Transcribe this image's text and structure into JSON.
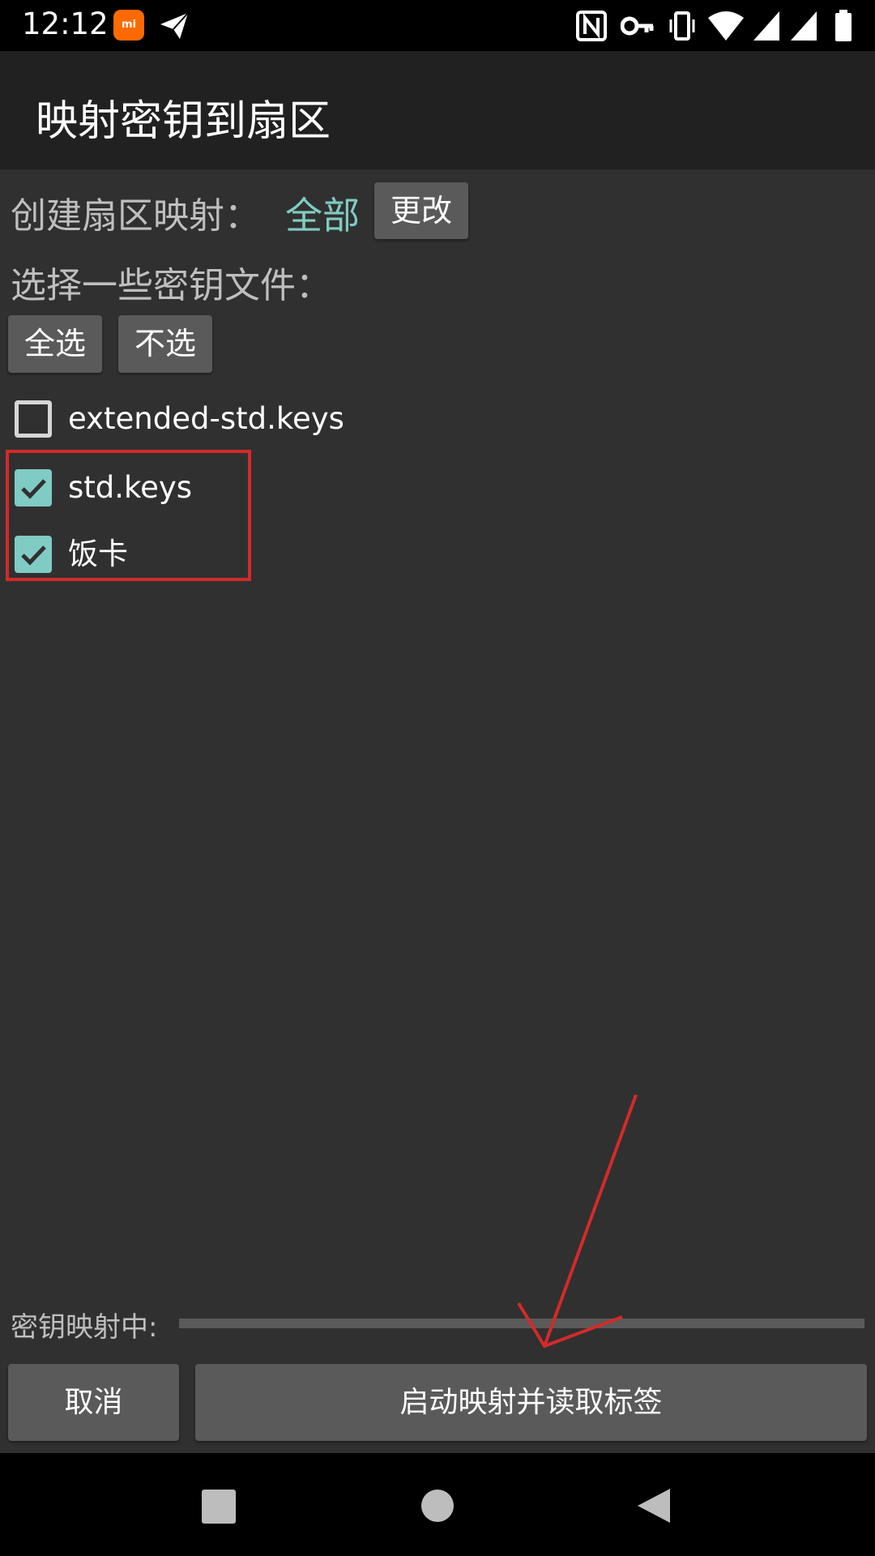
{
  "status_bar": {
    "time": "12:12",
    "mi_badge": "mi",
    "icons": [
      "mi-icon",
      "send-icon",
      "nfc-icon",
      "key-icon",
      "vibrate-icon",
      "wifi-icon",
      "signal-icon",
      "signal-icon",
      "battery-icon"
    ]
  },
  "app_bar": {
    "title": "映射密钥到扇区"
  },
  "sector_mapping": {
    "label": "创建扇区映射：",
    "value": "全部",
    "change_button": "更改"
  },
  "key_files": {
    "label": "选择一些密钥文件：",
    "select_all_button": "全选",
    "select_none_button": "不选",
    "items": [
      {
        "label": "extended-std.keys",
        "checked": false
      },
      {
        "label": "std.keys",
        "checked": true
      },
      {
        "label": "饭卡",
        "checked": true
      }
    ]
  },
  "progress": {
    "label": "密钥映射中:",
    "value": 0
  },
  "footer": {
    "cancel_button": "取消",
    "start_button": "启动映射并读取标签"
  },
  "colors": {
    "accent": "#80cbc4",
    "background": "#303030",
    "app_bar": "#212121",
    "annotation": "#d42a2a"
  },
  "nav_bar": {
    "icons": [
      "recent-apps-icon",
      "home-icon",
      "back-icon"
    ]
  }
}
